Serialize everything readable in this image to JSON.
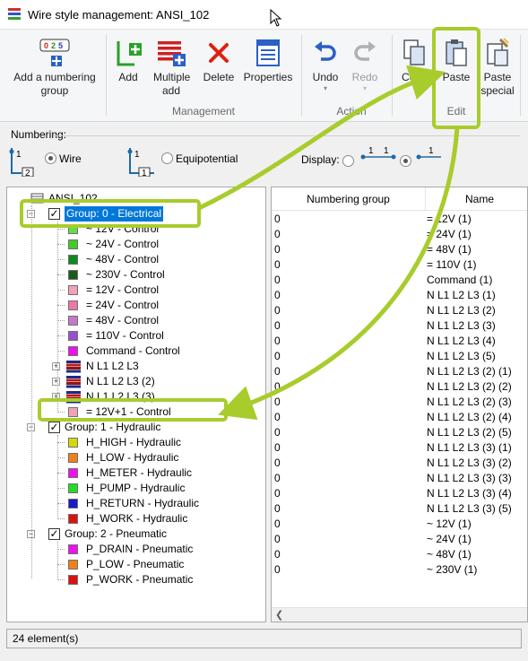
{
  "window": {
    "title": "Wire style management: ANSI_102"
  },
  "ribbon": {
    "buttons": {
      "add_numbering": "Add a numbering group",
      "add": "Add",
      "multiple_add": "Multiple add",
      "delete": "Delete",
      "properties": "Properties",
      "undo": "Undo",
      "redo": "Redo",
      "copy": "Copy",
      "paste": "Paste",
      "paste_special": "Paste special"
    },
    "groups": {
      "management": "Management",
      "action": "Action",
      "edit": "Edit"
    }
  },
  "numbering": {
    "label": "Numbering:",
    "wire": "Wire",
    "equipotential": "Equipotential",
    "display": "Display:",
    "wire_selected": true
  },
  "tree": {
    "root": "ANSI_102",
    "groups": [
      {
        "label": "Group: 0 - Electrical",
        "selected": true,
        "expanded": true,
        "items": [
          {
            "label": "~  12V - Control",
            "color": "#66dd44"
          },
          {
            "label": "~  24V - Control",
            "color": "#44cc22"
          },
          {
            "label": "~  48V - Control",
            "color": "#0e8a1e"
          },
          {
            "label": "~ 230V - Control",
            "color": "#1a5c1a"
          },
          {
            "label": "=  12V - Control",
            "color": "#f4a0b8"
          },
          {
            "label": "=  24V - Control",
            "color": "#ec78a8"
          },
          {
            "label": "=  48V - Control",
            "color": "#c678c8"
          },
          {
            "label": "= 110V - Control",
            "color": "#9a4ed0"
          },
          {
            "label": "Command - Control",
            "color": "#ee10ee"
          },
          {
            "label": "N L1 L2 L3",
            "multi": true
          },
          {
            "label": "N L1 L2 L3 (2)",
            "multi": true
          },
          {
            "label": "N L1 L2 L3 (3)",
            "multi": true
          },
          {
            "label": "=  12V+1 - Control",
            "color": "#f4a0b8"
          }
        ]
      },
      {
        "label": "Group: 1 - Hydraulic",
        "expanded": true,
        "items": [
          {
            "label": "H_HIGH - Hydraulic",
            "color": "#d8d800"
          },
          {
            "label": "H_LOW - Hydraulic",
            "color": "#f08018"
          },
          {
            "label": "H_METER - Hydraulic",
            "color": "#ee10ee"
          },
          {
            "label": "H_PUMP - Hydraulic",
            "color": "#22dd22"
          },
          {
            "label": "H_RETURN - Hydraulic",
            "color": "#1818cc"
          },
          {
            "label": "H_WORK - Hydraulic",
            "color": "#dd1010"
          }
        ]
      },
      {
        "label": "Group: 2 - Pneumatic",
        "expanded": true,
        "items": [
          {
            "label": "P_DRAIN - Pneumatic",
            "color": "#ee10ee"
          },
          {
            "label": "P_LOW - Pneumatic",
            "color": "#f08018"
          },
          {
            "label": "P_WORK - Pneumatic",
            "color": "#dd1010"
          }
        ]
      }
    ]
  },
  "list": {
    "columns": [
      "Numbering group",
      "Name"
    ],
    "rows": [
      [
        "0",
        "=  12V (1)"
      ],
      [
        "0",
        "=  24V (1)"
      ],
      [
        "0",
        "=  48V (1)"
      ],
      [
        "0",
        "= 110V (1)"
      ],
      [
        "0",
        "Command (1)"
      ],
      [
        "0",
        "N L1 L2 L3 (1)"
      ],
      [
        "0",
        "N L1 L2 L3 (2)"
      ],
      [
        "0",
        "N L1 L2 L3 (3)"
      ],
      [
        "0",
        "N L1 L2 L3 (4)"
      ],
      [
        "0",
        "N L1 L2 L3 (5)"
      ],
      [
        "0",
        "N L1 L2 L3 (2) (1)"
      ],
      [
        "0",
        "N L1 L2 L3 (2) (2)"
      ],
      [
        "0",
        "N L1 L2 L3 (2) (3)"
      ],
      [
        "0",
        "N L1 L2 L3 (2) (4)"
      ],
      [
        "0",
        "N L1 L2 L3 (2) (5)"
      ],
      [
        "0",
        "N L1 L2 L3 (3) (1)"
      ],
      [
        "0",
        "N L1 L2 L3 (3) (2)"
      ],
      [
        "0",
        "N L1 L2 L3 (3) (3)"
      ],
      [
        "0",
        "N L1 L2 L3 (3) (4)"
      ],
      [
        "0",
        "N L1 L2 L3 (3) (5)"
      ],
      [
        "0",
        "~  12V (1)"
      ],
      [
        "0",
        "~  24V (1)"
      ],
      [
        "0",
        "~  48V (1)"
      ],
      [
        "0",
        "~ 230V (1)"
      ]
    ]
  },
  "status": {
    "count": "24 element(s)"
  },
  "annotation_color": "#a8cc2c"
}
